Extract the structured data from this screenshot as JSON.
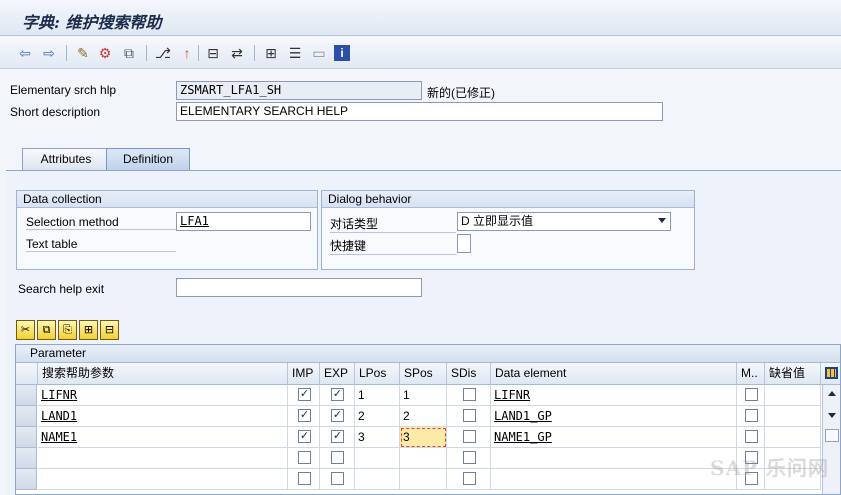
{
  "window": {
    "title": "字典: 维护搜索帮助"
  },
  "toolbar": {
    "icons": [
      "back-arrow-icon",
      "forward-arrow-icon",
      "display-change-icon",
      "other-object-icon",
      "check-icon",
      "activate-icon",
      "where-used-icon",
      "object-list-icon",
      "display-object-list-icon",
      "navigation-window-icon",
      "info-icon"
    ]
  },
  "header": {
    "name_label": "Elementary srch hlp",
    "name_value": "ZSMART_LFA1_SH",
    "status": "新的(已修正)",
    "desc_label": "Short description",
    "desc_value": "ELEMENTARY SEARCH HELP"
  },
  "tabs": [
    {
      "label": "Attributes",
      "active": false
    },
    {
      "label": "Definition",
      "active": true
    }
  ],
  "data_collection": {
    "title": "Data collection",
    "selection_method_label": "Selection method",
    "selection_method_value": "LFA1",
    "text_table_label": "Text table",
    "text_table_value": ""
  },
  "dialog_behavior": {
    "title": "Dialog behavior",
    "dialog_type_label": "对话类型",
    "dialog_type_value": "D 立即显示值",
    "hotkey_label": "快捷键",
    "hotkey_value": ""
  },
  "search_help_exit": {
    "label": "Search help exit",
    "value": ""
  },
  "table": {
    "title": "Parameter",
    "columns": [
      "搜索帮助参数",
      "IMP",
      "EXP",
      "LPos",
      "SPos",
      "SDis",
      "Data element",
      "M..",
      "缺省值"
    ],
    "rows": [
      {
        "param": "LIFNR",
        "imp": true,
        "exp": true,
        "lpos": "1",
        "spos": "1",
        "sdis": false,
        "data_element": "LIFNR",
        "mod": false,
        "default": ""
      },
      {
        "param": "LAND1",
        "imp": true,
        "exp": true,
        "lpos": "2",
        "spos": "2",
        "sdis": false,
        "data_element": "LAND1_GP",
        "mod": false,
        "default": ""
      },
      {
        "param": "NAME1",
        "imp": true,
        "exp": true,
        "lpos": "3",
        "spos": "3",
        "sdis": false,
        "data_element": "NAME1_GP",
        "mod": false,
        "default": ""
      },
      {
        "param": "",
        "imp": false,
        "exp": false,
        "lpos": "",
        "spos": "",
        "sdis": false,
        "data_element": "",
        "mod": false,
        "default": ""
      },
      {
        "param": "",
        "imp": false,
        "exp": false,
        "lpos": "",
        "spos": "",
        "sdis": false,
        "data_element": "",
        "mod": false,
        "default": ""
      }
    ]
  },
  "watermark": "SAP 乐问网"
}
